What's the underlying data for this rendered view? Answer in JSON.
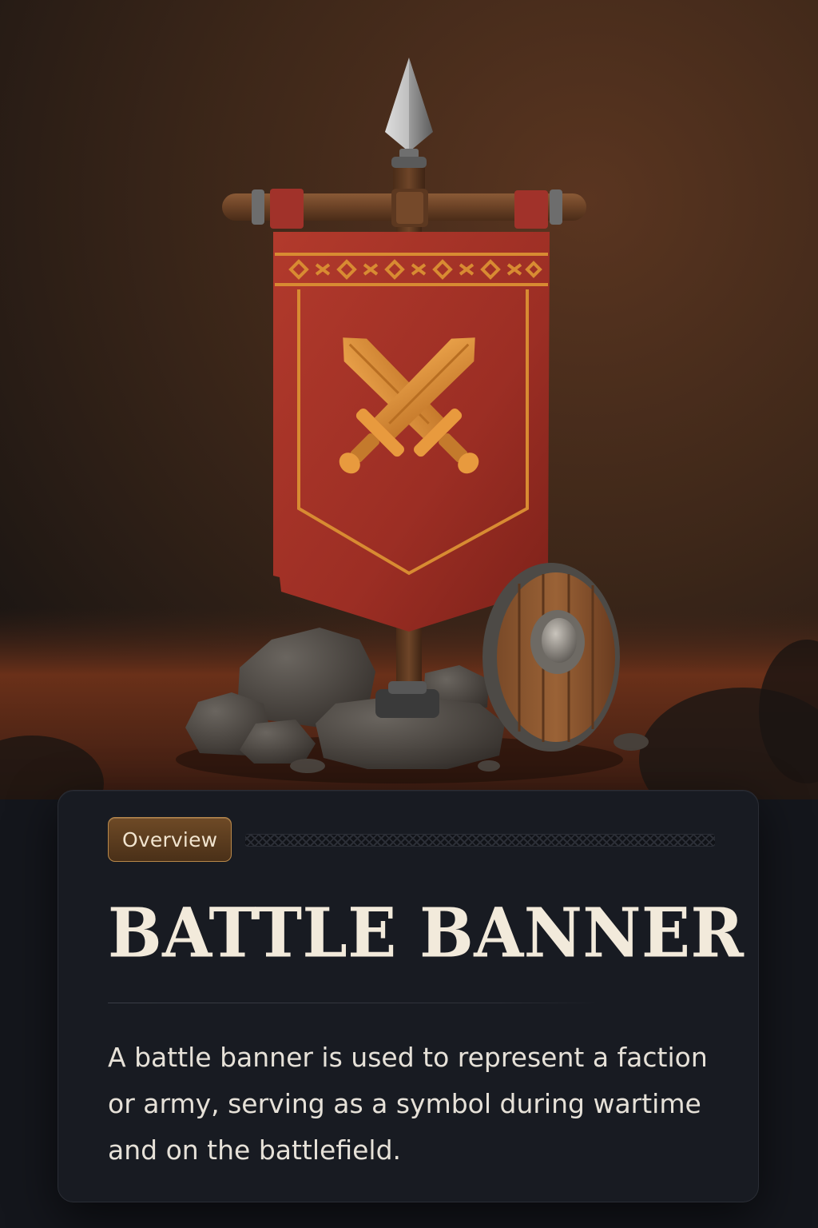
{
  "card": {
    "tag_label": "Overview",
    "title": "BATTLE BANNER",
    "description": "A battle banner is used to represent a faction or army, serving as a symbol during wartime and on the battlefield."
  },
  "icons": {
    "banner_emblem": "crossed-swords-icon",
    "shield": "round-shield-icon"
  },
  "colors": {
    "banner_red": "#a42f25",
    "gold_trim": "#d88b32",
    "card_bg": "#181b22",
    "tag_bg": "#5c3c1f",
    "title_text": "#f2eadb"
  }
}
